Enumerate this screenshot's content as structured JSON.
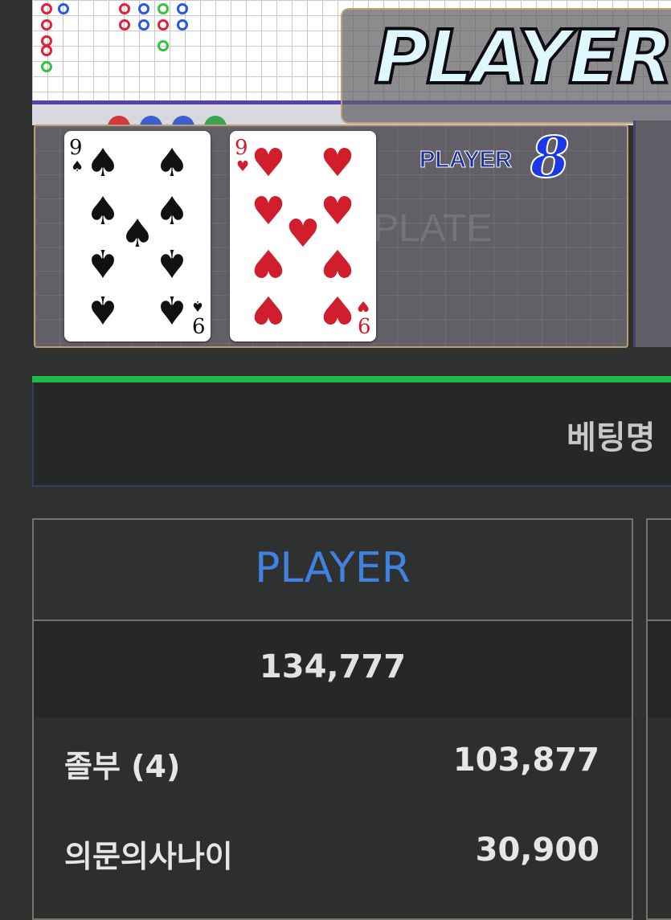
{
  "game": {
    "banner_text": "PLAYER",
    "result_label": "PLAYER",
    "result_value": "8",
    "watermark": "PLATE",
    "cards": [
      {
        "rank": "9",
        "suit": "spades",
        "suit_symbol": "♠"
      },
      {
        "rank": "9",
        "suit": "hearts",
        "suit_symbol": "♥"
      }
    ],
    "colors": {
      "player_blue": "#1a38e6",
      "banker_red": "#e3203b",
      "tie_green": "#33c43c",
      "scoreboard_border": "#5b3fb3"
    }
  },
  "betting": {
    "title": "베팅명",
    "accent_color": "#1fba4c"
  },
  "player_table": {
    "header": "PLAYER",
    "header_color": "#3f82e0",
    "total": "134,777",
    "rows": [
      {
        "name": "졸부 (4)",
        "amount": "103,877"
      },
      {
        "name": "의문의사나이",
        "amount": "30,900"
      }
    ]
  }
}
